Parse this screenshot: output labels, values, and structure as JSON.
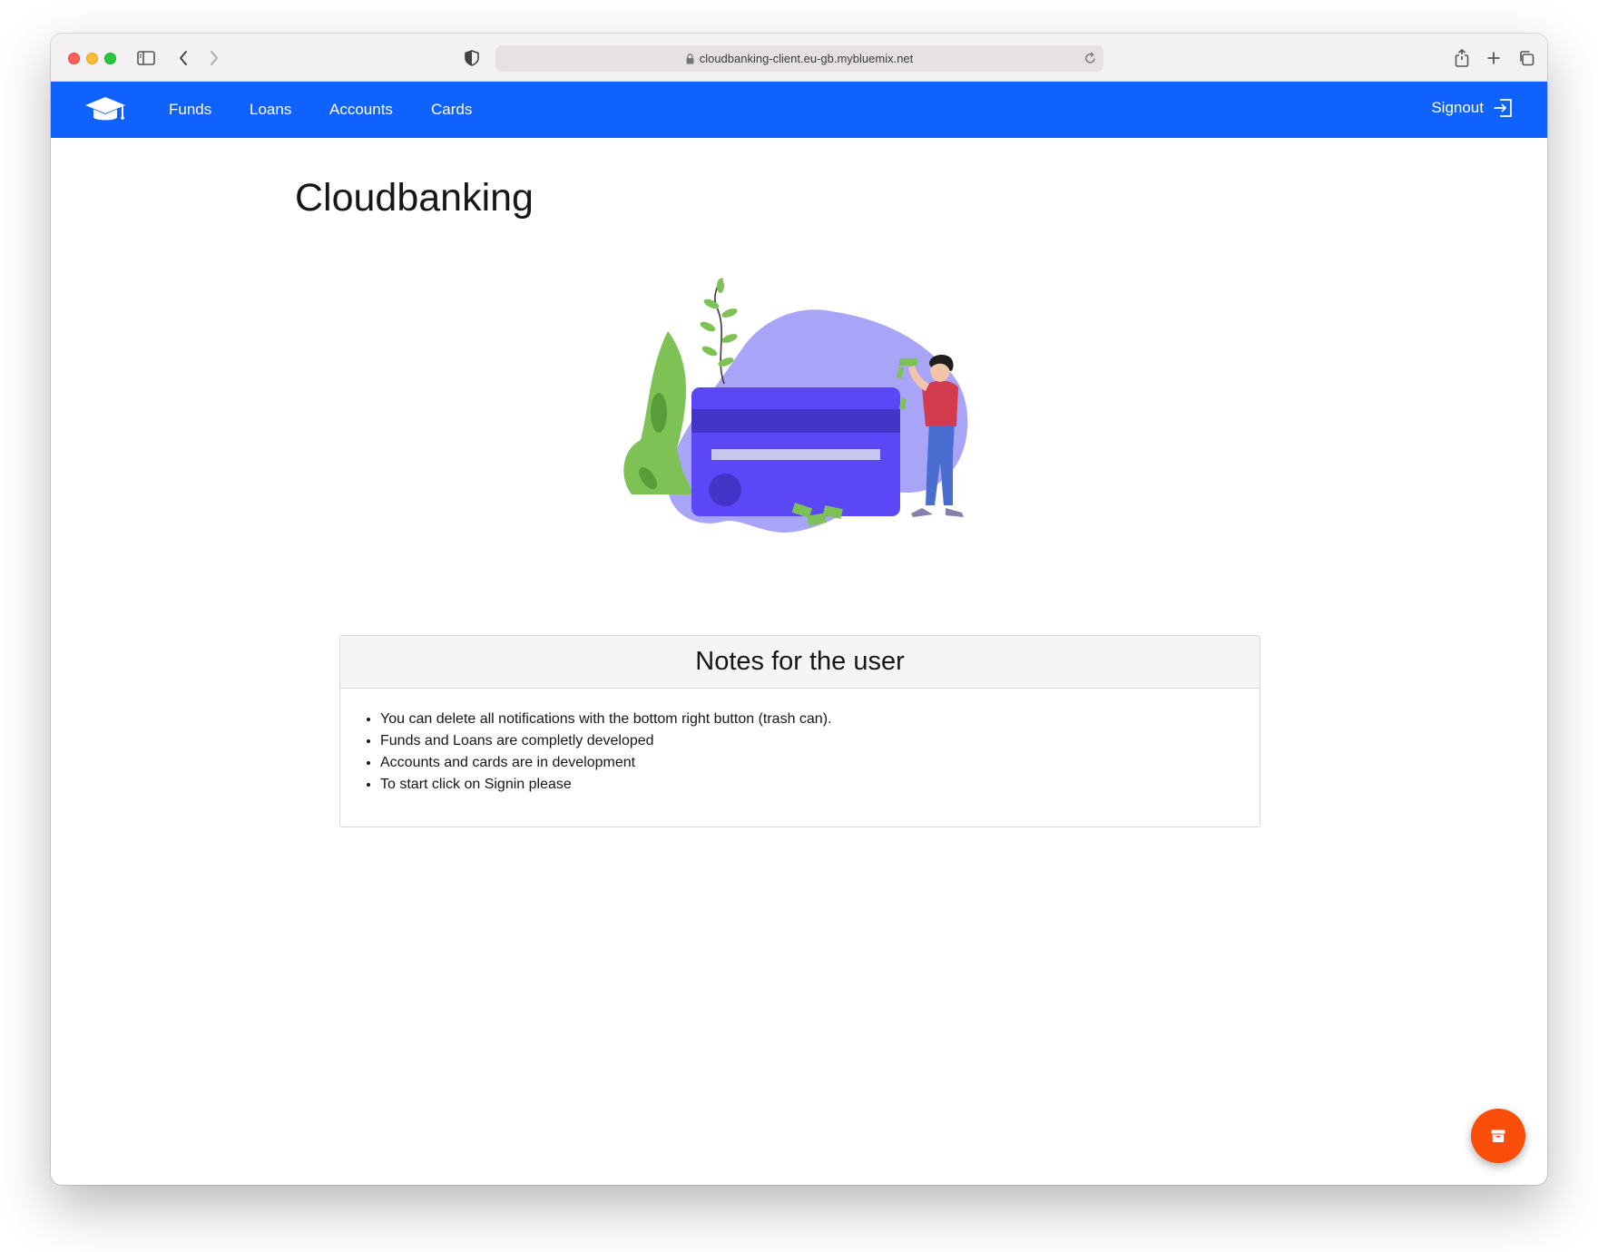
{
  "browser": {
    "url": "cloudbanking-client.eu-gb.mybluemix.net"
  },
  "navbar": {
    "items": [
      {
        "label": "Funds"
      },
      {
        "label": "Loans"
      },
      {
        "label": "Accounts"
      },
      {
        "label": "Cards"
      }
    ],
    "signout_label": "Signout"
  },
  "main": {
    "title": "Cloudbanking",
    "notes": {
      "heading": "Notes for the user",
      "items": [
        "You can delete all notifications with the bottom right button (trash can).",
        "Funds and Loans are completly developed",
        "Accounts and cards are in development",
        "To start click on Signin please"
      ]
    }
  },
  "colors": {
    "navbar": "#0f62fe",
    "fab": "#fa4d0a"
  },
  "icons": {
    "logo": "graduation-cap-icon",
    "signout": "logout-arrow-icon",
    "fab": "archive-icon"
  }
}
